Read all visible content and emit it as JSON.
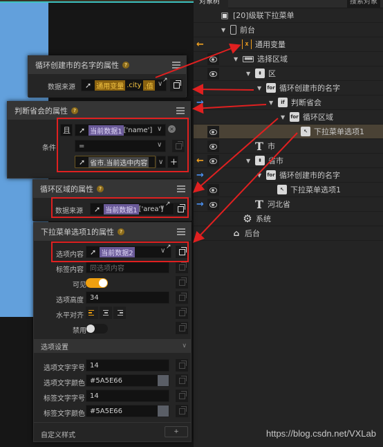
{
  "tree_panel": {
    "tab_label": "对象树",
    "search_label": "搜索对象",
    "rows": [
      {
        "label": "[20]级联下拉菜单",
        "icon": "app-icon"
      },
      {
        "label": "前台",
        "icon": "phone-icon"
      },
      {
        "label": "通用变量",
        "icon": "variable-icon"
      },
      {
        "label": "选择区域",
        "icon": "dropdown-bar-icon"
      },
      {
        "label": "区",
        "icon": "select-icon"
      },
      {
        "label": "循环创建市的名字",
        "icon": "for-icon"
      },
      {
        "label": "判断省会",
        "icon": "if-icon"
      },
      {
        "label": "循环区域",
        "icon": "for-icon"
      },
      {
        "label": "下拉菜单选项1",
        "icon": "option-icon"
      },
      {
        "label": "市",
        "icon": "text-icon"
      },
      {
        "label": "省市",
        "icon": "select-icon"
      },
      {
        "label": "循环创建市的名字",
        "icon": "for-icon"
      },
      {
        "label": "下拉菜单选项1",
        "icon": "option-icon"
      },
      {
        "label": "河北省",
        "icon": "text-icon"
      },
      {
        "label": "系统",
        "icon": "gear-icon"
      },
      {
        "label": "后台",
        "icon": "server-icon"
      }
    ],
    "icon_glyphs": {
      "for": "for",
      "if": "if",
      "var": "x",
      "T": "T"
    }
  },
  "panel_loop_city": {
    "title": "循环创建市的名字的属性",
    "help": "?",
    "field_label": "数据来源",
    "value_var": "通用变量",
    "value_path1": ".city",
    "value_path2": ".值"
  },
  "panel_if": {
    "title": "判断省会的属性",
    "help": "?",
    "field_label": "条件",
    "logic": "且",
    "left_var": "当前数据1",
    "left_key": "['name']",
    "operator": "=",
    "right_value": "省市.当前选中内容",
    "add_symbol": "+"
  },
  "panel_loop_area": {
    "title": "循环区域的属性",
    "help": "?",
    "field_label": "数据来源",
    "value_var": "当前数据1",
    "value_key": "['area']"
  },
  "panel_option": {
    "title": "下拉菜单选项1的属性",
    "help": "?",
    "content_label": "选项内容",
    "content_value": "当前数据2",
    "tag_label": "标签内容",
    "tag_placeholder": "同选项内容",
    "visible_label": "可见",
    "visible_on": true,
    "height_label": "选项高度",
    "height_value": "34",
    "align_label": "水平对齐",
    "align_selected": "left",
    "disabled_label": "禁用",
    "disabled_on": false,
    "section_title": "选项设置",
    "opt_font_size_label": "选项文字字号",
    "opt_font_size_value": "14",
    "opt_font_color_label": "选项文字颜色",
    "opt_font_color_value": "#5A5E66",
    "tag_font_size_label": "标签文字字号",
    "tag_font_size_value": "14",
    "tag_font_color_label": "标签文字颜色",
    "tag_font_color_value": "#5A5E66",
    "custom_style_label": "自定义样式",
    "custom_style_add": "+"
  },
  "colors": {
    "accent_orange": "#F0A010",
    "annotation_red": "#E02020",
    "swatch": "#5A5E66"
  },
  "watermark": "https://blog.csdn.net/VXLab"
}
